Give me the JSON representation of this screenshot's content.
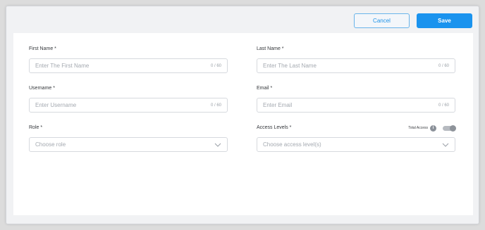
{
  "toolbar": {
    "cancel_label": "Cancel",
    "save_label": "Save"
  },
  "form": {
    "first_name": {
      "label": "First Name *",
      "placeholder": "Enter The First Name",
      "counter": "0 / 60"
    },
    "last_name": {
      "label": "Last Name *",
      "placeholder": "Enter The Last Name",
      "counter": "0 / 60"
    },
    "username": {
      "label": "Username *",
      "placeholder": "Enter Username",
      "counter": "0 / 60"
    },
    "email": {
      "label": "Email *",
      "placeholder": "Enter Email",
      "counter": "0 / 60"
    },
    "role": {
      "label": "Role *",
      "placeholder": "Choose role"
    },
    "access_levels": {
      "label": "Access Levels *",
      "placeholder": "Choose access level(s)",
      "total_access_label": "Total Access",
      "total_access_on": false
    }
  },
  "icons": {
    "info": "info-icon",
    "chevron": "chevron-down-icon"
  },
  "colors": {
    "accent": "#1a93ee",
    "border": "#d6d9de",
    "placeholder": "#a4a9b0"
  }
}
